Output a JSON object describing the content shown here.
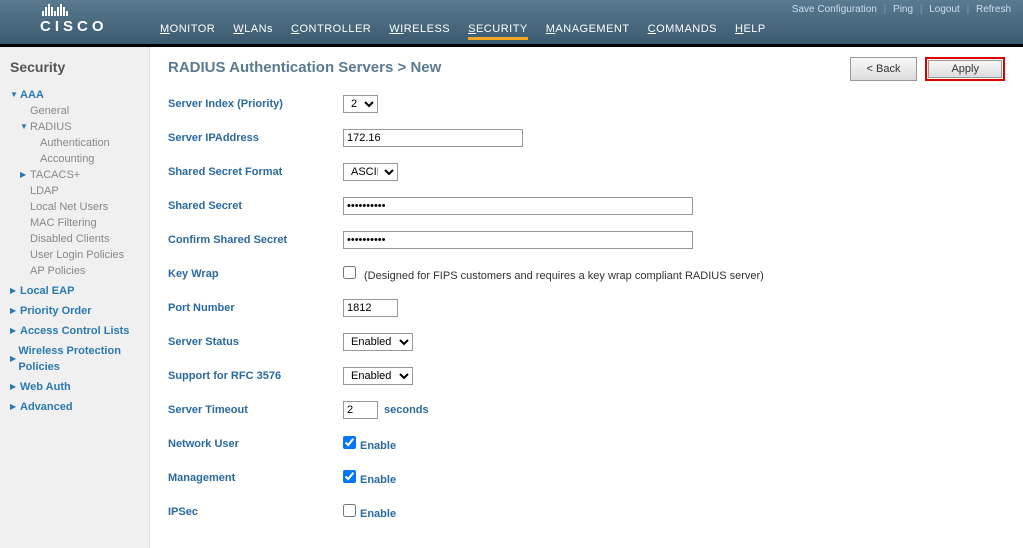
{
  "brand": "CISCO",
  "topnav": {
    "save": "Save Configuration",
    "ping": "Ping",
    "logout": "Logout",
    "refresh": "Refresh"
  },
  "mainnav": [
    "MONITOR",
    "WLANs",
    "CONTROLLER",
    "WIRELESS",
    "SECURITY",
    "MANAGEMENT",
    "COMMANDS",
    "HELP"
  ],
  "mainnav_active": "SECURITY",
  "sidebar": {
    "title": "Security",
    "aaa": "AAA",
    "general": "General",
    "radius": "RADIUS",
    "authentication": "Authentication",
    "accounting": "Accounting",
    "tacacs": "TACACS+",
    "ldap": "LDAP",
    "localnet": "Local Net Users",
    "macfilter": "MAC Filtering",
    "disabled": "Disabled Clients",
    "loginpol": "User Login Policies",
    "appol": "AP Policies",
    "localeap": "Local EAP",
    "priority": "Priority Order",
    "acl": "Access Control Lists",
    "wpp": "Wireless Protection Policies",
    "webauth": "Web Auth",
    "advanced": "Advanced"
  },
  "page": {
    "title_a": "RADIUS Authentication Servers",
    "title_sep": " > ",
    "title_b": "New",
    "back": "< Back",
    "apply": "Apply"
  },
  "form": {
    "server_index_label": "Server Index (Priority)",
    "server_index_value": "2",
    "server_ip_label": "Server IPAddress",
    "server_ip_value": "172.16",
    "secret_format_label": "Shared Secret Format",
    "secret_format_value": "ASCII",
    "secret_label": "Shared Secret",
    "secret_value": "••••••••••",
    "confirm_label": "Confirm Shared Secret",
    "confirm_value": "••••••••••",
    "keywrap_label": "Key Wrap",
    "keywrap_note": "(Designed for FIPS customers and requires a key wrap compliant RADIUS server)",
    "port_label": "Port Number",
    "port_value": "1812",
    "status_label": "Server Status",
    "status_value": "Enabled",
    "rfc_label": "Support for RFC 3576",
    "rfc_value": "Enabled",
    "timeout_label": "Server Timeout",
    "timeout_value": "2",
    "timeout_unit": "seconds",
    "netuser_label": "Network User",
    "mgmt_label": "Management",
    "ipsec_label": "IPSec",
    "enable": "Enable"
  }
}
